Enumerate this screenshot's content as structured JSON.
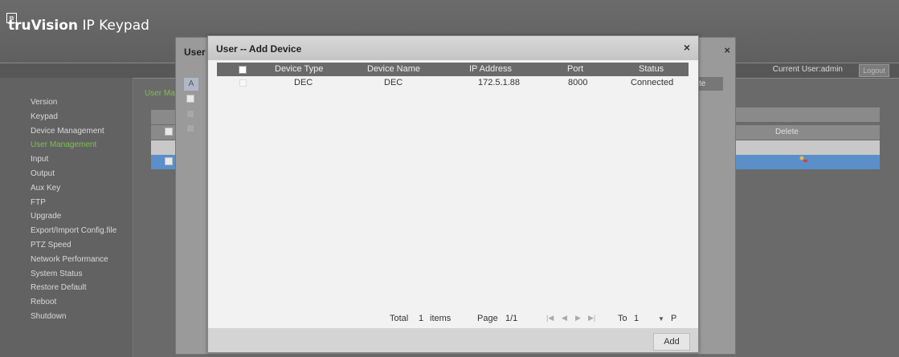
{
  "header": {
    "brand_bold": "truVision",
    "brand_rest": "IP Keypad"
  },
  "topbar": {
    "current_user": "Current User:admin",
    "logout_label": "Logout"
  },
  "sidebar": {
    "items": [
      {
        "label": "Version"
      },
      {
        "label": "Keypad"
      },
      {
        "label": "Device Management"
      },
      {
        "label": "User Management",
        "active": true
      },
      {
        "label": "Input"
      },
      {
        "label": "Output"
      },
      {
        "label": "Aux Key"
      },
      {
        "label": "FTP"
      },
      {
        "label": "Upgrade"
      },
      {
        "label": "Export/Import Config.file"
      },
      {
        "label": "PTZ Speed"
      },
      {
        "label": "Network Performance"
      },
      {
        "label": "System Status"
      },
      {
        "label": "Restore Default"
      },
      {
        "label": "Reboot"
      },
      {
        "label": "Shutdown"
      }
    ]
  },
  "background": {
    "section_label": "User Ma",
    "add_label": "A",
    "delete_header": "Delete",
    "te_label": "te",
    "user_dialog_title": "User"
  },
  "modal": {
    "title": "User -- Add Device",
    "columns": [
      "Device Type",
      "Device Name",
      "IP Address",
      "Port",
      "Status"
    ],
    "rows": [
      {
        "device_type": "DEC",
        "device_name": "DEC",
        "ip_address": "172.5.1.88",
        "port": "8000",
        "status": "Connected"
      }
    ],
    "pager": {
      "total_label": "Total",
      "total_count": "1",
      "items_label": "items",
      "page_label": "Page",
      "page_value": "1/1",
      "to_label": "To",
      "to_value": "1",
      "p_label": "P"
    },
    "add_label": "Add"
  }
}
